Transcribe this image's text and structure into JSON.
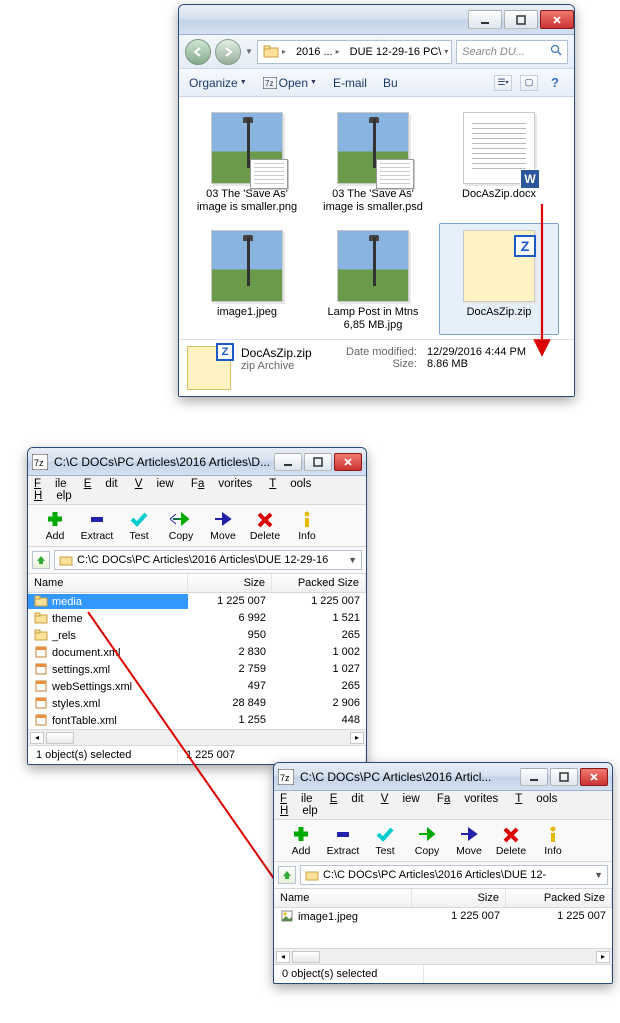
{
  "explorer": {
    "nav": {
      "back_tip": "Back",
      "fwd_tip": "Forward"
    },
    "breadcrumb": {
      "seg1": "2016 ...",
      "seg2": "DUE 12-29-16 PC\\"
    },
    "search_placeholder": "Search DU...",
    "commands": {
      "organize": "Organize",
      "open": "Open",
      "email": "E-mail",
      "burn": "Bu"
    },
    "tiles": [
      {
        "filename": "03 The 'Save As' image is smaller.png",
        "kind": "lamp-mini"
      },
      {
        "filename": "03 The 'Save As' image is smaller.psd",
        "kind": "lamp-mini"
      },
      {
        "filename": "DocAsZip.docx",
        "kind": "docx"
      },
      {
        "filename": "image1.jpeg",
        "kind": "lamp"
      },
      {
        "filename": "Lamp Post in Mtns 6,85 MB.jpg",
        "kind": "lamp"
      },
      {
        "filename": "DocAsZip.zip",
        "kind": "zip",
        "selected": true
      }
    ],
    "details": {
      "name": "DocAsZip.zip",
      "type": "zip Archive",
      "mod_label": "Date modified:",
      "mod_value": "12/29/2016 4:44 PM",
      "size_label": "Size:",
      "size_value": "8.86 MB"
    }
  },
  "sevenz_a": {
    "title": "C:\\C DOCs\\PC Articles\\2016 Articles\\D...",
    "menu": [
      "File",
      "Edit",
      "View",
      "Favorites",
      "Tools",
      "Help"
    ],
    "tools": [
      "Add",
      "Extract",
      "Test",
      "Copy",
      "Move",
      "Delete",
      "Info"
    ],
    "path": "C:\\C DOCs\\PC Articles\\2016 Articles\\DUE 12-29-16",
    "cols": {
      "name": "Name",
      "size": "Size",
      "packed": "Packed Size"
    },
    "rows": [
      {
        "name": "media",
        "icon": "folder",
        "size": "1 225 007",
        "packed": "1 225 007",
        "selected": true
      },
      {
        "name": "theme",
        "icon": "folder",
        "size": "6 992",
        "packed": "1 521"
      },
      {
        "name": "_rels",
        "icon": "folder",
        "size": "950",
        "packed": "265"
      },
      {
        "name": "document.xml",
        "icon": "xml",
        "size": "2 830",
        "packed": "1 002"
      },
      {
        "name": "settings.xml",
        "icon": "xml",
        "size": "2 759",
        "packed": "1 027"
      },
      {
        "name": "webSettings.xml",
        "icon": "xml",
        "size": "497",
        "packed": "265"
      },
      {
        "name": "styles.xml",
        "icon": "xml",
        "size": "28 849",
        "packed": "2 906"
      },
      {
        "name": "fontTable.xml",
        "icon": "xml",
        "size": "1 255",
        "packed": "448"
      }
    ],
    "status": {
      "left": "1 object(s) selected",
      "right": "1 225 007"
    }
  },
  "sevenz_b": {
    "title": "C:\\C DOCs\\PC Articles\\2016 Articl...",
    "menu": [
      "File",
      "Edit",
      "View",
      "Favorites",
      "Tools",
      "Help"
    ],
    "tools": [
      "Add",
      "Extract",
      "Test",
      "Copy",
      "Move",
      "Delete",
      "Info"
    ],
    "path": "C:\\C DOCs\\PC Articles\\2016 Articles\\DUE 12-",
    "cols": {
      "name": "Name",
      "size": "Size",
      "packed": "Packed Size"
    },
    "rows": [
      {
        "name": "image1.jpeg",
        "icon": "img",
        "size": "1 225 007",
        "packed": "1 225 007"
      }
    ],
    "status": {
      "left": "0 object(s) selected",
      "right": ""
    }
  }
}
